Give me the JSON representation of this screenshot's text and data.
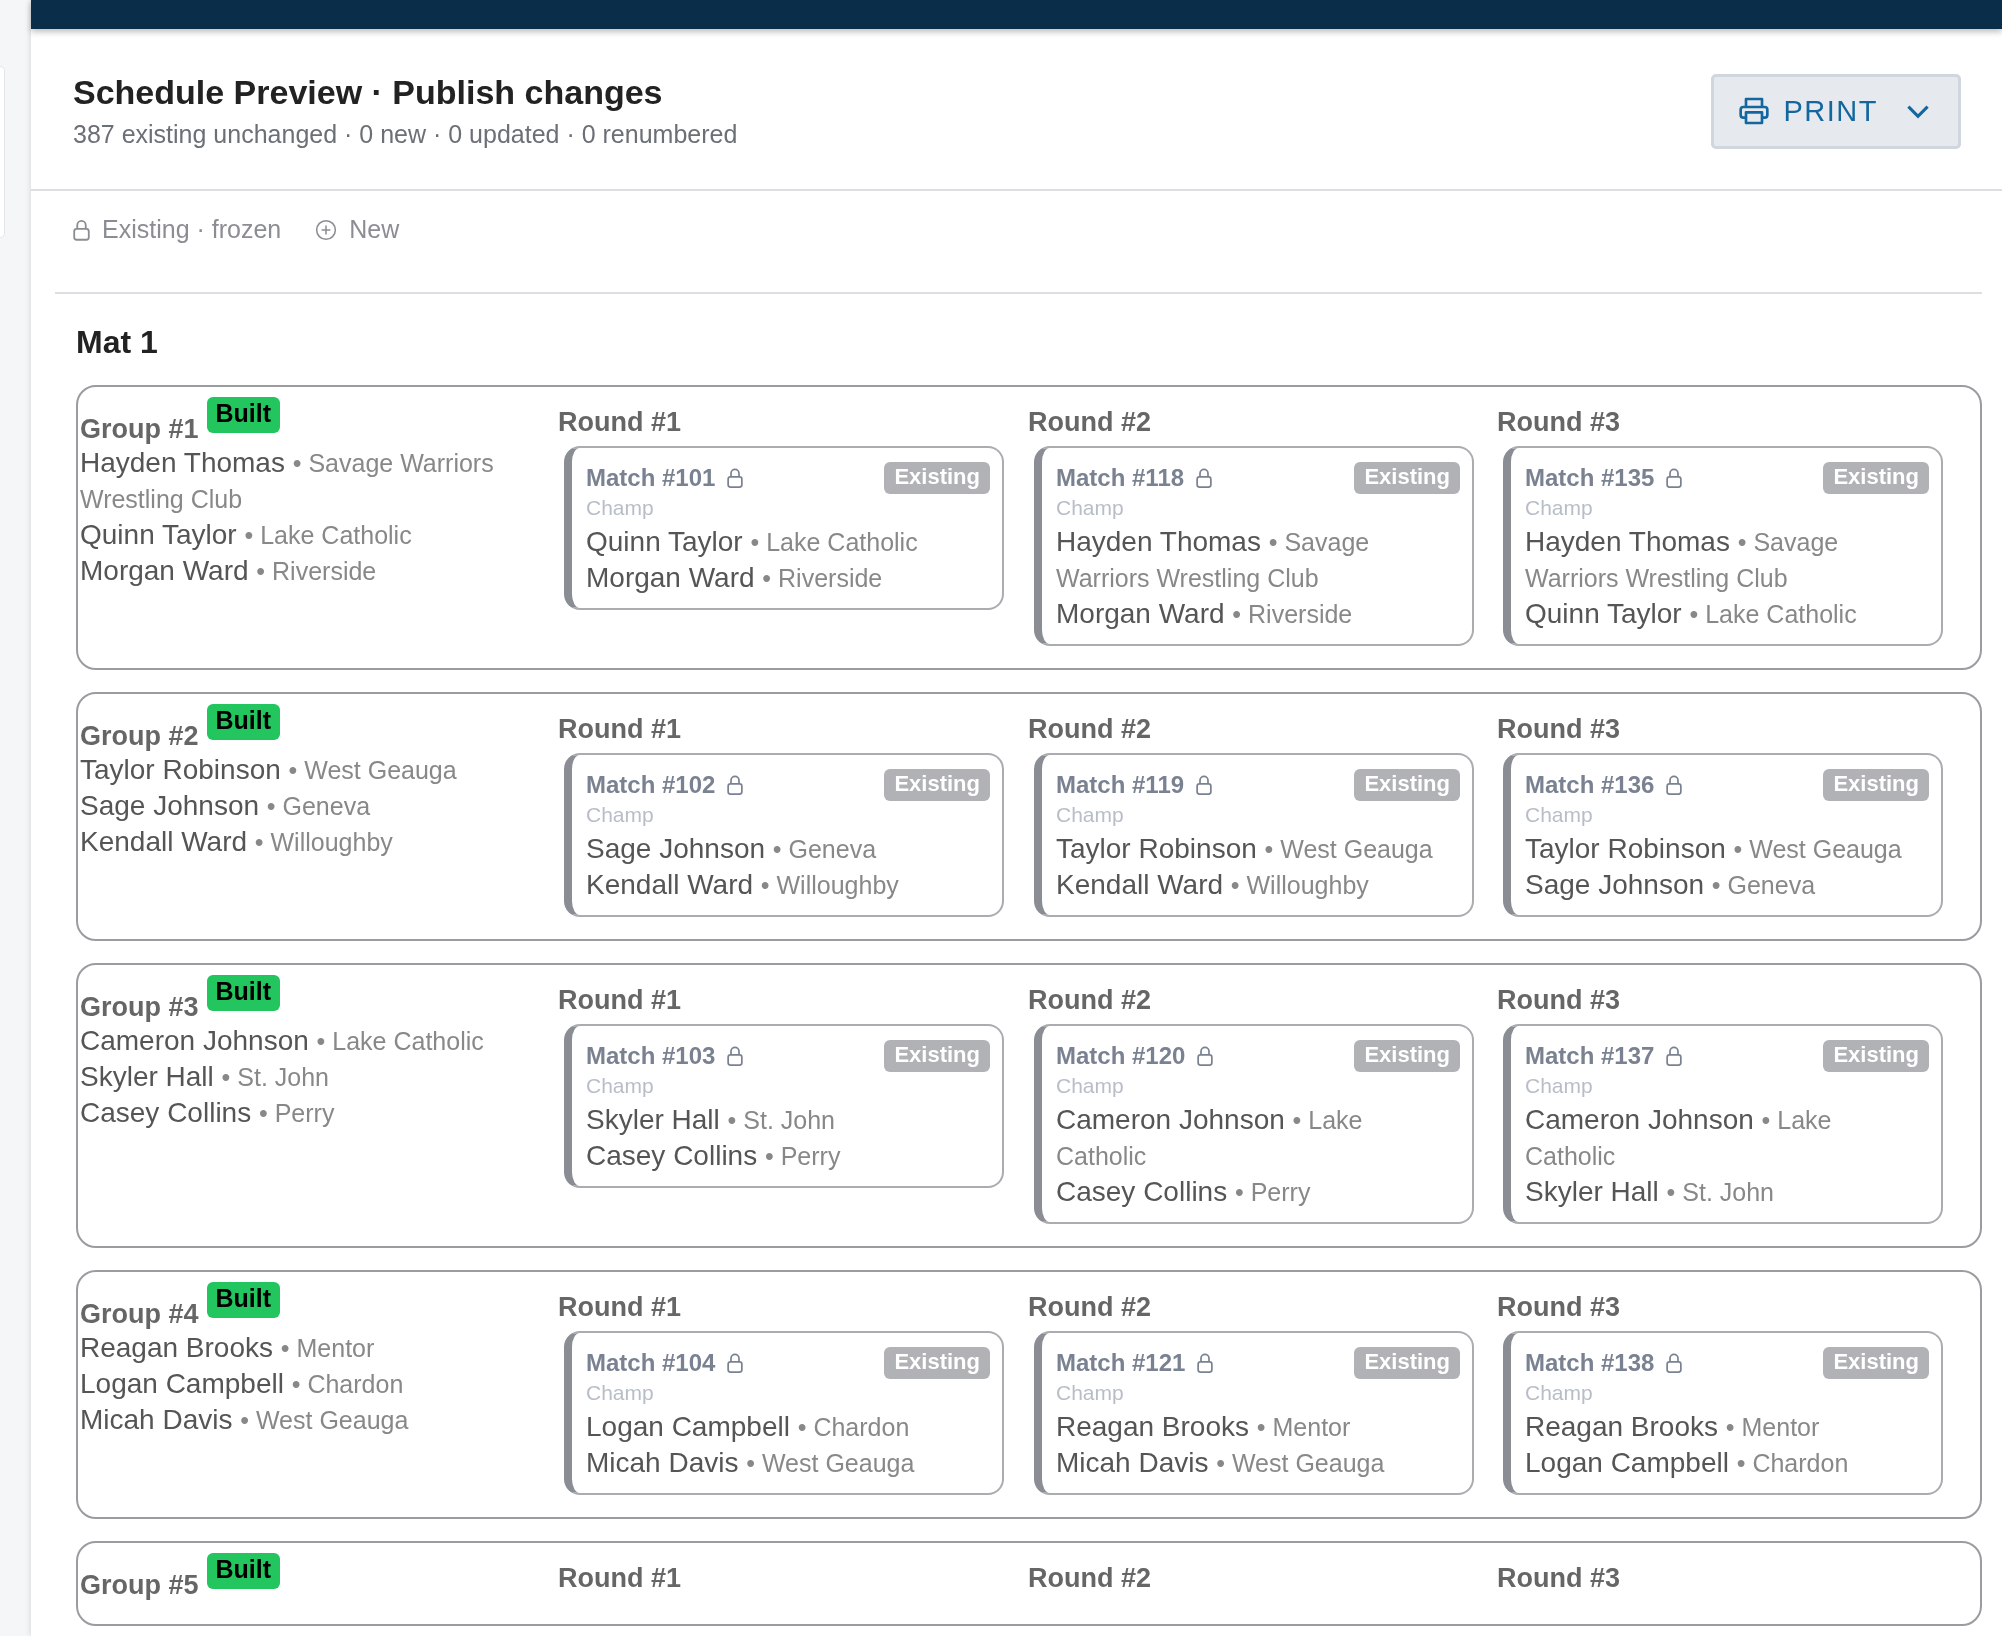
{
  "header": {
    "title": "Schedule Preview · Publish changes",
    "summary": "387 existing unchanged · 0 new · 0 updated · 0 renumbered",
    "print_button": "PRINT"
  },
  "legend": [
    {
      "kind": "lock",
      "label": "Existing · frozen"
    },
    {
      "kind": "plus",
      "label": "New"
    }
  ],
  "mat": {
    "title": "Mat 1",
    "groups": [
      {
        "title": "Group #1",
        "badge": "Built",
        "wrestlers": [
          {
            "name": "Hayden Thomas",
            "team": "• Savage Warriors Wrestling Club"
          },
          {
            "name": "Quinn Taylor",
            "team": "• Lake Catholic"
          },
          {
            "name": "Morgan Ward",
            "team": "• Riverside"
          }
        ],
        "rounds": [
          {
            "title": "Round #1",
            "match": {
              "title": "Match #101",
              "locked": true,
              "status": "Existing",
              "division": "Champ",
              "wrestlers": [
                {
                  "name": "Quinn Taylor",
                  "team": "• Lake Catholic"
                },
                {
                  "name": "Morgan Ward",
                  "team": "• Riverside"
                }
              ]
            }
          },
          {
            "title": "Round #2",
            "match": {
              "title": "Match #118",
              "locked": true,
              "status": "Existing",
              "division": "Champ",
              "wrestlers": [
                {
                  "name": "Hayden Thomas",
                  "team": "• Savage Warriors Wrestling Club"
                },
                {
                  "name": "Morgan Ward",
                  "team": "• Riverside"
                }
              ]
            }
          },
          {
            "title": "Round #3",
            "match": {
              "title": "Match #135",
              "locked": true,
              "status": "Existing",
              "division": "Champ",
              "wrestlers": [
                {
                  "name": "Hayden Thomas",
                  "team": "• Savage Warriors Wrestling Club"
                },
                {
                  "name": "Quinn Taylor",
                  "team": "• Lake Catholic"
                }
              ]
            }
          }
        ]
      },
      {
        "title": "Group #2",
        "badge": "Built",
        "wrestlers": [
          {
            "name": "Taylor Robinson",
            "team": "• West Geauga"
          },
          {
            "name": "Sage Johnson",
            "team": "• Geneva"
          },
          {
            "name": "Kendall Ward",
            "team": "• Willoughby"
          }
        ],
        "rounds": [
          {
            "title": "Round #1",
            "match": {
              "title": "Match #102",
              "locked": true,
              "status": "Existing",
              "division": "Champ",
              "wrestlers": [
                {
                  "name": "Sage Johnson",
                  "team": "• Geneva"
                },
                {
                  "name": "Kendall Ward",
                  "team": "• Willoughby"
                }
              ]
            }
          },
          {
            "title": "Round #2",
            "match": {
              "title": "Match #119",
              "locked": true,
              "status": "Existing",
              "division": "Champ",
              "wrestlers": [
                {
                  "name": "Taylor Robinson",
                  "team": "• West Geauga"
                },
                {
                  "name": "Kendall Ward",
                  "team": "• Willoughby"
                }
              ]
            }
          },
          {
            "title": "Round #3",
            "match": {
              "title": "Match #136",
              "locked": true,
              "status": "Existing",
              "division": "Champ",
              "wrestlers": [
                {
                  "name": "Taylor Robinson",
                  "team": "• West Geauga"
                },
                {
                  "name": "Sage Johnson",
                  "team": "• Geneva"
                }
              ]
            }
          }
        ]
      },
      {
        "title": "Group #3",
        "badge": "Built",
        "wrestlers": [
          {
            "name": "Cameron Johnson",
            "team": "• Lake Catholic"
          },
          {
            "name": "Skyler Hall",
            "team": "• St. John"
          },
          {
            "name": "Casey Collins",
            "team": "• Perry"
          }
        ],
        "rounds": [
          {
            "title": "Round #1",
            "match": {
              "title": "Match #103",
              "locked": true,
              "status": "Existing",
              "division": "Champ",
              "wrestlers": [
                {
                  "name": "Skyler Hall",
                  "team": "• St. John"
                },
                {
                  "name": "Casey Collins",
                  "team": "• Perry"
                }
              ]
            }
          },
          {
            "title": "Round #2",
            "match": {
              "title": "Match #120",
              "locked": true,
              "status": "Existing",
              "division": "Champ",
              "wrestlers": [
                {
                  "name": "Cameron Johnson",
                  "team": "• Lake Catholic"
                },
                {
                  "name": "Casey Collins",
                  "team": "• Perry"
                }
              ]
            }
          },
          {
            "title": "Round #3",
            "match": {
              "title": "Match #137",
              "locked": true,
              "status": "Existing",
              "division": "Champ",
              "wrestlers": [
                {
                  "name": "Cameron Johnson",
                  "team": "• Lake Catholic"
                },
                {
                  "name": "Skyler Hall",
                  "team": "• St. John"
                }
              ]
            }
          }
        ]
      },
      {
        "title": "Group #4",
        "badge": "Built",
        "wrestlers": [
          {
            "name": "Reagan Brooks",
            "team": "• Mentor"
          },
          {
            "name": "Logan Campbell",
            "team": "• Chardon"
          },
          {
            "name": "Micah Davis",
            "team": "• West Geauga"
          }
        ],
        "rounds": [
          {
            "title": "Round #1",
            "match": {
              "title": "Match #104",
              "locked": true,
              "status": "Existing",
              "division": "Champ",
              "wrestlers": [
                {
                  "name": "Logan Campbell",
                  "team": "• Chardon"
                },
                {
                  "name": "Micah Davis",
                  "team": "• West Geauga"
                }
              ]
            }
          },
          {
            "title": "Round #2",
            "match": {
              "title": "Match #121",
              "locked": true,
              "status": "Existing",
              "division": "Champ",
              "wrestlers": [
                {
                  "name": "Reagan Brooks",
                  "team": "• Mentor"
                },
                {
                  "name": "Micah Davis",
                  "team": "• West Geauga"
                }
              ]
            }
          },
          {
            "title": "Round #3",
            "match": {
              "title": "Match #138",
              "locked": true,
              "status": "Existing",
              "division": "Champ",
              "wrestlers": [
                {
                  "name": "Reagan Brooks",
                  "team": "• Mentor"
                },
                {
                  "name": "Logan Campbell",
                  "team": "• Chardon"
                }
              ]
            }
          }
        ]
      },
      {
        "title": "Group #5",
        "badge": "Built",
        "rounds": [
          {
            "title": "Round #1"
          },
          {
            "title": "Round #2"
          },
          {
            "title": "Round #3"
          }
        ]
      }
    ]
  }
}
